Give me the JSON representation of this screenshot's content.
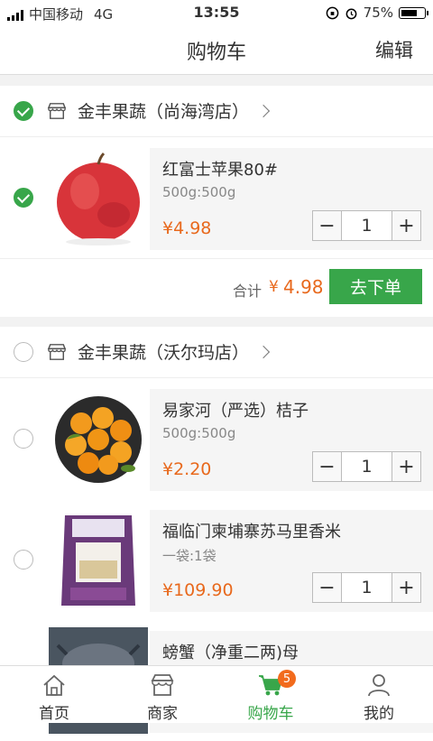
{
  "status": {
    "carrier": "中国移动",
    "network": "4G",
    "time": "13:55",
    "battery": "75%",
    "battery_level": 0.75
  },
  "nav": {
    "title": "购物车",
    "edit": "编辑"
  },
  "stores": [
    {
      "name": "金丰果蔬（尚海湾店）",
      "checked": true,
      "items": [
        {
          "name": "红富士苹果80#",
          "spec": "500g:500g",
          "price": "¥4.98",
          "qty": "1",
          "checked": true,
          "image": "apple"
        }
      ],
      "total_label": "合计",
      "total_currency": "¥",
      "total_value": "4.98",
      "order_button": "去下单"
    },
    {
      "name": "金丰果蔬（沃尔玛店）",
      "checked": false,
      "items": [
        {
          "name": "易家河（严选）桔子",
          "spec": "500g:500g",
          "price": "¥2.20",
          "qty": "1",
          "checked": false,
          "image": "oranges"
        },
        {
          "name": "福临门柬埔寨苏马里香米",
          "spec": "一袋:1袋",
          "price": "¥109.90",
          "qty": "1",
          "checked": false,
          "image": "rice"
        },
        {
          "name": "螃蟹（净重二两)母",
          "image": "crab"
        }
      ]
    }
  ],
  "tabbar": {
    "tabs": [
      {
        "label": "首页",
        "icon": "home-icon"
      },
      {
        "label": "商家",
        "icon": "store-icon"
      },
      {
        "label": "购物车",
        "icon": "cart-icon",
        "badge": "5",
        "active": true
      },
      {
        "label": "我的",
        "icon": "person-icon"
      }
    ]
  },
  "colors": {
    "accent": "#38a64a",
    "price": "#e8691d",
    "badge": "#f26b1d"
  }
}
